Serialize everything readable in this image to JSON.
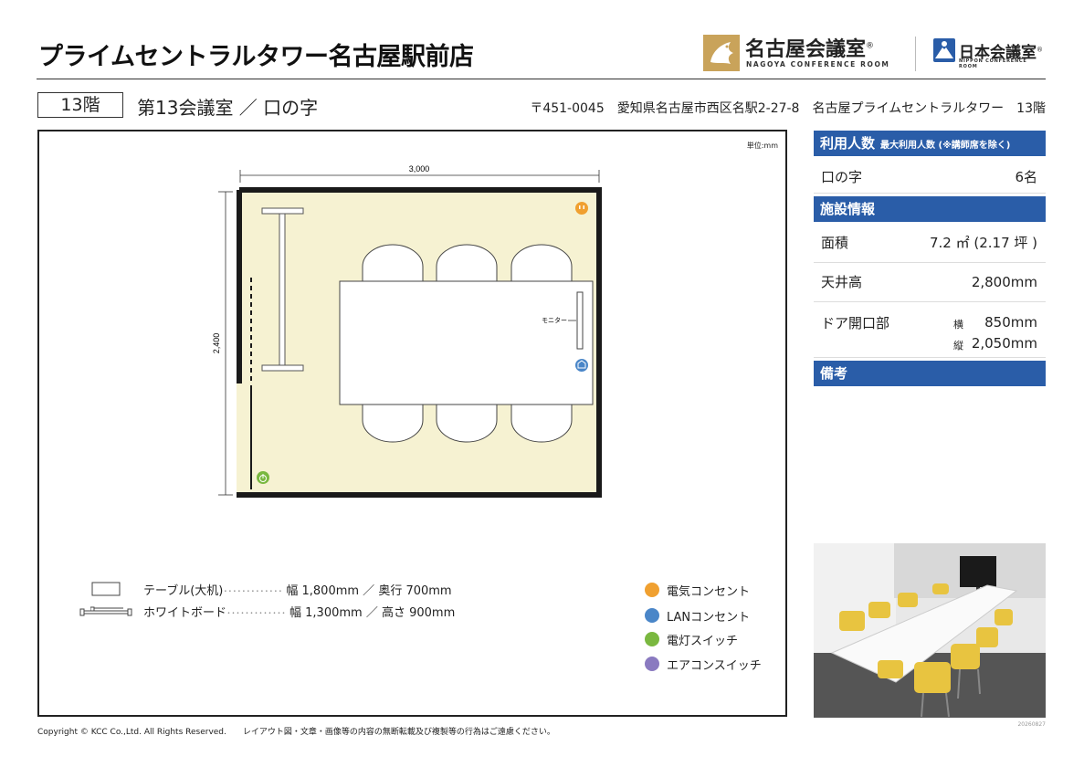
{
  "header": {
    "title": "プライムセントラルタワー名古屋駅前店",
    "logo_nagoya_name": "名古屋会議室",
    "logo_nagoya_sub": "NAGOYA CONFERENCE ROOM",
    "logo_nippon_name": "日本会議室",
    "logo_nippon_sub": "NIPPON CONFERENCE ROOM",
    "registered": "®"
  },
  "room": {
    "floor": "13階",
    "name": "第13会議室 ／ 口の字",
    "address": "〒451-0045　愛知県名古屋市西区名駅2-27-8　名古屋プライムセントラルタワー　13階"
  },
  "plan": {
    "unit": "単位:mm",
    "width_dim": "3,000",
    "height_dim": "2,400",
    "monitor_label": "モニター",
    "colors": {
      "floor": "#f6f2d2",
      "wall": "#1a1a1a",
      "power": "#f0a030",
      "lan": "#4a86c8",
      "light": "#7ab840",
      "aircon": "#8a7ac0"
    }
  },
  "legend": {
    "table_label": "テーブル(大机)",
    "table_dots": "･････････････",
    "table_size": "幅 1,800mm ／ 奥行 700mm",
    "board_label": "ホワイトボード",
    "board_dots": "･････････････",
    "board_size": "幅 1,300mm ／ 高さ 900mm",
    "power": "電気コンセント",
    "lan": "LANコンセント",
    "light": "電灯スイッチ",
    "aircon": "エアコンスイッチ"
  },
  "sidebar": {
    "capacity_head": "利用人数",
    "capacity_note": "最大利用人数 (※講師席を除く)",
    "layout": "口の字",
    "capacity": "6名",
    "facility_head": "施設情報",
    "area_label": "面積",
    "area_value": "7.2 ㎡ (2.17 坪 )",
    "ceiling_label": "天井高",
    "ceiling_value": "2,800mm",
    "door_label": "ドア開口部",
    "door_w_label": "横",
    "door_w_value": "850mm",
    "door_h_label": "縦",
    "door_h_value": "2,050mm",
    "notes_head": "備考"
  },
  "photo_code": "20260827",
  "footer": "Copyright © KCC Co.,Ltd. All Rights Reserved.　　レイアウト図・文章・画像等の内容の無断転載及び複製等の行為はご遠慮ください。"
}
